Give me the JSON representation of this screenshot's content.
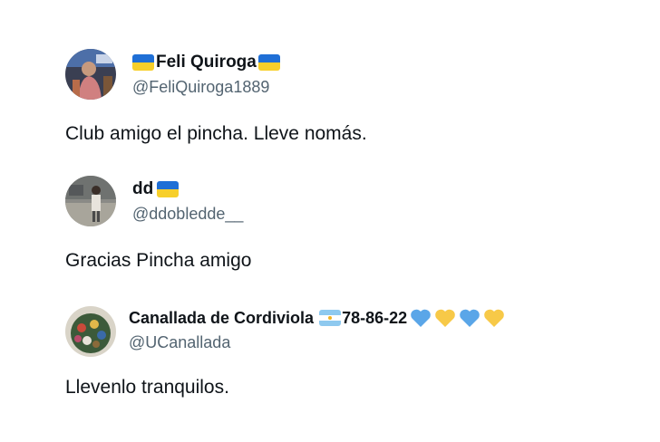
{
  "tweets": [
    {
      "name": "Feli Quiroga",
      "handle": "@FeliQuiroga1889",
      "text": "Club amigo el pincha. Lleve nomás.",
      "name_flags": [
        "ukraine-flag-icon",
        "ukraine-flag-icon"
      ]
    },
    {
      "name": "dd",
      "handle": "@ddobledde__",
      "text": "Gracias Pincha amigo",
      "name_flags": [
        "ukraine-flag-icon"
      ]
    },
    {
      "name": "Canallada de Cordiviola",
      "name_suffix": "78-86-22",
      "handle": "@UCanallada",
      "text": "Llevenlo tranquilos.",
      "name_flags": [
        "argentina-flag-icon"
      ],
      "hearts": [
        "blue",
        "yellow",
        "blue",
        "yellow"
      ]
    }
  ],
  "colors": {
    "text": "#0f1419",
    "handle": "#536471",
    "heart_blue": "#5aa6e8",
    "heart_yellow": "#f7c948"
  }
}
